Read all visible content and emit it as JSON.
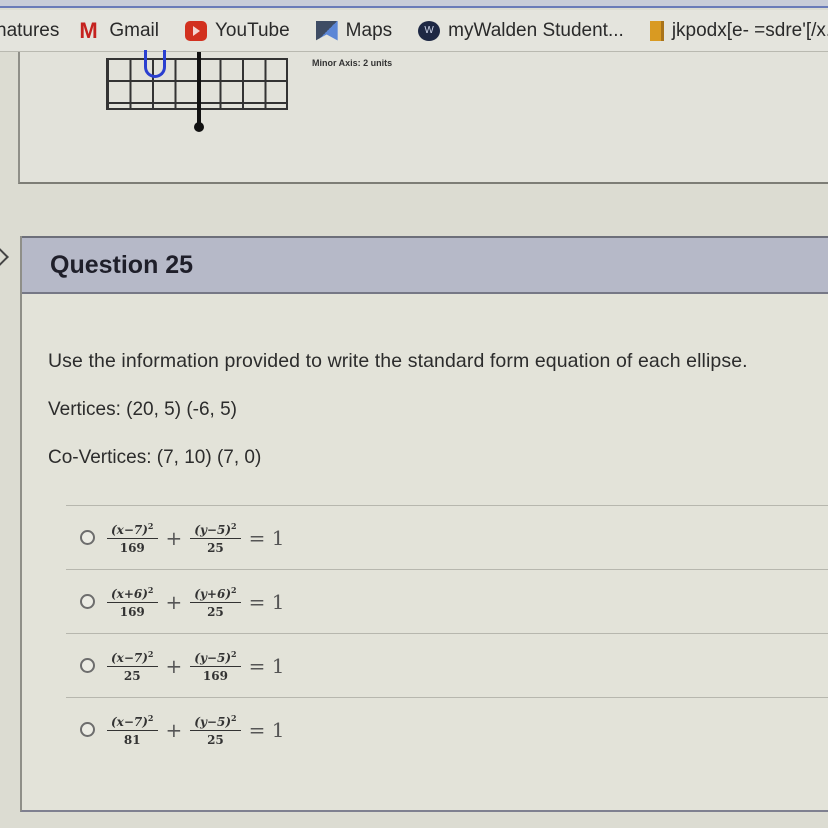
{
  "bookmarks": [
    {
      "label": "natures",
      "icon": "none"
    },
    {
      "label": "Gmail",
      "icon": "gmail-icon"
    },
    {
      "label": "YouTube",
      "icon": "youtube-icon"
    },
    {
      "label": "Maps",
      "icon": "maps-icon"
    },
    {
      "label": "myWalden Student...",
      "icon": "walden-icon"
    },
    {
      "label": "jkpodx[e- =sdre'[/x...",
      "icon": "bookmark-folder-icon"
    }
  ],
  "previous_question": {
    "graph_caption": "Minor Axis: 2 units"
  },
  "question": {
    "title": "Question 25",
    "prompt": "Use the information provided to write the standard form equation of each ellipse.",
    "vertices": "Vertices: (20, 5) (-6, 5)",
    "co_vertices": "Co-Vertices: (7, 10) (7, 0)",
    "options": [
      {
        "x_num": "(x−7)",
        "x_den": "169",
        "y_num": "(y−5)",
        "y_den": "25",
        "exp": "2",
        "plus": "+",
        "eq": "= 1",
        "selected": false
      },
      {
        "x_num": "(x+6)",
        "x_den": "169",
        "y_num": "(y+6)",
        "y_den": "25",
        "exp": "2",
        "plus": "+",
        "eq": "= 1",
        "selected": false
      },
      {
        "x_num": "(x−7)",
        "x_den": "25",
        "y_num": "(y−5)",
        "y_den": "169",
        "exp": "2",
        "plus": "+",
        "eq": "= 1",
        "selected": false
      },
      {
        "x_num": "(x−7)",
        "x_den": "81",
        "y_num": "(y−5)",
        "y_den": "25",
        "exp": "2",
        "plus": "+",
        "eq": "= 1",
        "selected": false
      }
    ]
  }
}
